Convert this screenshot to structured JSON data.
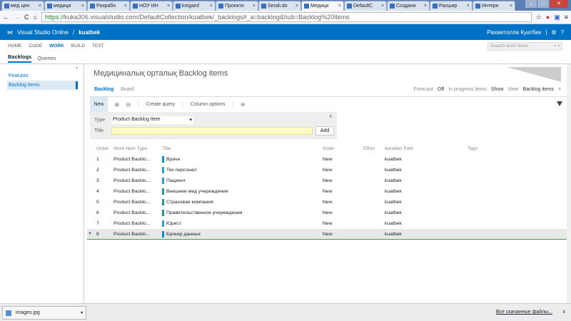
{
  "browser": {
    "tabs": [
      "мед цен",
      "медици",
      "Разрабо",
      "НОУ ИН",
      "knigainf",
      "Проекти",
      "Serali.do",
      "Медици",
      "DefaultC",
      "Создани",
      "Расшир",
      "Интерн"
    ],
    "active_tab": 7,
    "url_scheme": "https://",
    "url_rest": "kuka306.visualstudio.com/DefaultCollection/kuatbek/_backlogs#_a=backlog&hub=Backlog%20items"
  },
  "header": {
    "product": "Visual Studio Online",
    "separator": "/",
    "project": "kuatbek",
    "user": "Рахметолла Куатбек"
  },
  "nav": {
    "items": [
      "HOME",
      "CODE",
      "WORK",
      "BUILD",
      "TEST"
    ],
    "active": "WORK",
    "search_placeholder": "Search work items"
  },
  "subnav": {
    "items": [
      "Backlogs",
      "Queries"
    ],
    "active": "Backlogs"
  },
  "sidebar": {
    "items": [
      "Features",
      "Backlog items"
    ],
    "selected": "Backlog items"
  },
  "main": {
    "title": "Медициналық орталық Backlog items",
    "pivots": [
      "Backlog",
      "Board"
    ],
    "forecast_label": "Forecast",
    "forecast_value": "Off",
    "inprogress_label": "In progress items",
    "inprogress_value": "Show",
    "view_label": "View",
    "view_value": "Backlog items",
    "toolbar": {
      "new": "New",
      "create_query": "Create query",
      "column_options": "Column options"
    },
    "add_panel": {
      "type_label": "Type",
      "type_value": "Product Backlog Item",
      "title_label": "Title",
      "title_value": "",
      "add": "Add",
      "close": "x"
    },
    "columns": [
      "Order",
      "Work Item Type",
      "Title",
      "State",
      "Effort",
      "Iteration Path",
      "Tags"
    ],
    "rows": [
      {
        "order": "1",
        "type": "Product Backlo...",
        "title": "Врачи",
        "state": "New",
        "effort": "",
        "iteration": "kuatbek",
        "tags": "",
        "color": "#0a8bd6"
      },
      {
        "order": "2",
        "type": "Product Backlo...",
        "title": "Тех персонал",
        "state": "New",
        "effort": "",
        "iteration": "kuatbek",
        "tags": "",
        "color": "#2aa0dc"
      },
      {
        "order": "3",
        "type": "Product Backlo...",
        "title": "Пациент",
        "state": "New",
        "effort": "",
        "iteration": "kuatbek",
        "tags": "",
        "color": "#2aa0dc"
      },
      {
        "order": "4",
        "type": "Product Backlo...",
        "title": "Внешнее мед учереждения",
        "state": "New",
        "effort": "",
        "iteration": "kuatbek",
        "tags": "",
        "color": "#1f9a8e"
      },
      {
        "order": "5",
        "type": "Product Backlo...",
        "title": "Страховая компания",
        "state": "New",
        "effort": "",
        "iteration": "kuatbek",
        "tags": "",
        "color": "#1f9a8e"
      },
      {
        "order": "6",
        "type": "Product Backlo...",
        "title": "Правительственное учереждения",
        "state": "New",
        "effort": "",
        "iteration": "kuatbek",
        "tags": "",
        "color": "#1f9a8e"
      },
      {
        "order": "7",
        "type": "Product Backlo...",
        "title": "Юрист",
        "state": "New",
        "effort": "",
        "iteration": "kuatbek",
        "tags": "",
        "color": "#2aa0dc"
      },
      {
        "order": "8",
        "type": "Product Backlo...",
        "title": "Брокер данных",
        "state": "New",
        "effort": "",
        "iteration": "kuatbek",
        "tags": "",
        "color": "#0a8bd6"
      }
    ]
  },
  "downloads": {
    "file": "images.jpg",
    "all": "Все скачанные файлы...",
    "close": "x"
  }
}
